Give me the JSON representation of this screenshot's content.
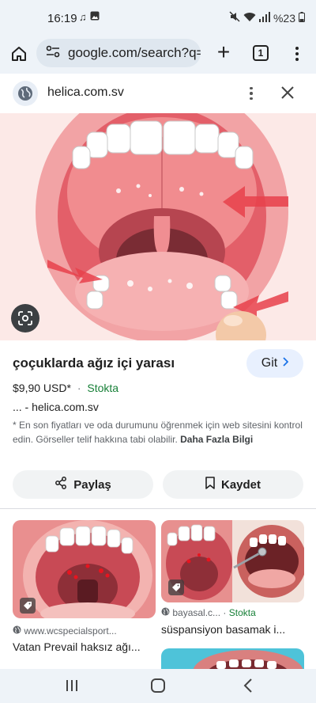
{
  "status_bar": {
    "time": "16:19",
    "left_icons": [
      "music-note-icon",
      "image-icon"
    ],
    "right_icons": [
      "mute-icon",
      "wifi-icon",
      "signal-icon"
    ],
    "battery": "%23"
  },
  "browser": {
    "url": "google.com/search?q=",
    "tab_count": "1"
  },
  "site": {
    "name": "helica.com.sv"
  },
  "product": {
    "title": "çoçuklarda ağız içi yarası",
    "visit_label": "Git",
    "price": "$9,90 USD*",
    "separator": "·",
    "stock": "Stokta",
    "source": "... - helica.com.sv",
    "disclaimer": "* En son fiyatları ve oda durumunu öğrenmek için web sitesini kontrol edin. Görseller telif hakkına tabi olabilir.",
    "disclaimer_more": "Daha Fazla Bilgi"
  },
  "actions": {
    "share": "Paylaş",
    "save": "Kaydet"
  },
  "related": [
    {
      "source": "www.wcspecialsport...",
      "stock": "",
      "title": "Vatan Prevail haksız ağı..."
    },
    {
      "source": "bayasal.c...",
      "stock": "Stokta",
      "title": "süspansiyon basamak i..."
    }
  ],
  "colors": {
    "accent": "#1a73e8",
    "stock_green": "#188038",
    "chrome_bg": "#eef3f8"
  }
}
